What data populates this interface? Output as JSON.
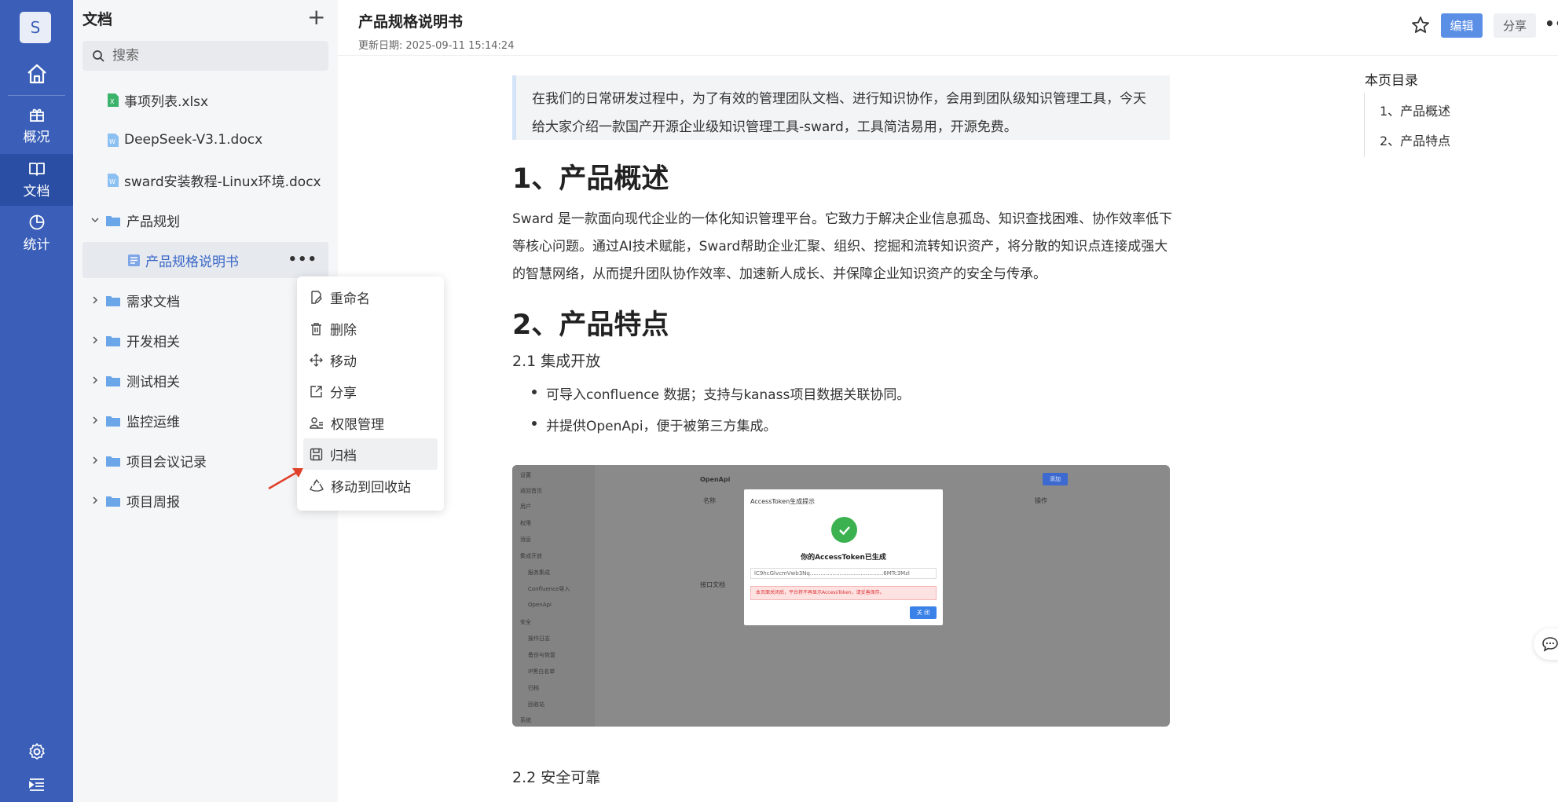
{
  "rail": {
    "avatar": "S",
    "items": [
      {
        "label": "概况"
      },
      {
        "label": "文档"
      },
      {
        "label": "统计"
      }
    ]
  },
  "tree": {
    "title": "文档",
    "add": "+",
    "search_placeholder": "搜索",
    "files": [
      "事项列表.xlsx",
      "DeepSeek-V3.1.docx",
      "sward安装教程-Linux环境.docx"
    ],
    "folder_open": "产品规划",
    "selected_doc": "产品规格说明书",
    "folders": [
      "需求文档",
      "开发相关",
      "测试相关",
      "监控运维",
      "项目会议记录",
      "项目周报"
    ],
    "more": "•••"
  },
  "context_menu": {
    "items": [
      "重命名",
      "删除",
      "移动",
      "分享",
      "权限管理",
      "归档",
      "移动到回收站"
    ]
  },
  "header": {
    "title": "产品规格说明书",
    "date_label": "更新日期:",
    "date_value": "2025-09-11 15:14:24",
    "edit": "编辑",
    "share": "分享",
    "more": "•••"
  },
  "content": {
    "quote": "在我们的日常研发过程中，为了有效的管理团队文档、进行知识协作，会用到团队级知识管理工具，今天给大家介绍一款国产开源企业级知识管理工具-sward，工具简洁易用，开源免费。",
    "h1_1": "1、产品概述",
    "para": "Sward 是一款面向现代企业的一体化知识管理平台。它致力于解决企业信息孤岛、知识查找困难、协作效率低下等核心问题。通过AI技术赋能，Sward帮助企业汇聚、组织、挖掘和流转知识资产，将分散的知识点连接成强大的智慧网络，从而提升团队协作效率、加速新人成长、并保障企业知识资产的安全与传承。",
    "h1_2": "2、产品特点",
    "h3_1": "2.1 集成开放",
    "bullets": [
      "可导入confluence 数据；支持与kanass项目数据关联协同。",
      "并提供OpenApi，便于被第三方集成。"
    ],
    "h3_2": "2.2 安全可靠"
  },
  "screenshot": {
    "side_items": [
      "设置",
      "返回首页",
      "用户",
      "权限",
      "消息",
      "集成开放",
      "服务集成",
      "Confluence导入",
      "OpenApi",
      "安全",
      "操作日志",
      "备份与恢复",
      "IP黑白名单",
      "归档",
      "回收站",
      "系统"
    ],
    "page_title": "OpenApi",
    "add": "添加",
    "col_name": "名称",
    "col_op": "操作",
    "section": "接口文档",
    "modal_title": "AccessToken生成提示",
    "modal_msg": "你的AccessToken已生成",
    "token": "lC9hcGlvcmVwb3Nq..........................................6MTc3Mzl",
    "warn": "本页面关闭后，平台将不再显示AccessToken，请妥善保存。",
    "close": "关 闭"
  },
  "toc": {
    "title": "本页目录",
    "items": [
      "1、产品概述",
      "2、产品特点"
    ]
  }
}
